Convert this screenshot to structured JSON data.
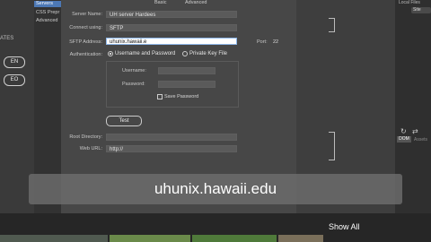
{
  "left_panel": {
    "label": "ATES",
    "buttons": [
      "EN",
      "EO"
    ]
  },
  "categories": [
    "Servers",
    "CSS Prepr",
    "Advanced"
  ],
  "tabs": [
    "Basic",
    "Advanced"
  ],
  "form": {
    "server_name_label": "Server Name:",
    "server_name_value": "UH server Hardees",
    "connect_using_label": "Connect using:",
    "connect_using_value": "SFTP",
    "sftp_address_label": "SFTP Address:",
    "sftp_address_value": "uhunix.hawaii.e",
    "port_label": "Port:",
    "port_value": "22",
    "authentication_label": "Authentication:",
    "auth_option_1": "Username and Password",
    "auth_option_2": "Private Key File",
    "username_label": "Username:",
    "password_label": "Password:",
    "save_password_label": "Save Password",
    "test_button": "Test",
    "root_directory_label": "Root Directory:",
    "web_url_label": "Web URL:",
    "web_url_value": "http://"
  },
  "right_panel": {
    "local_files": "Local Files",
    "site": "Site",
    "dom_tab": "DOM",
    "assets_tab": "Assets"
  },
  "caption": "uhunix.hawaii.edu",
  "bottom": {
    "show_all": "Show All"
  },
  "colors": {
    "selected_category": "#4c78b5",
    "caption_bg": "#6e6e6e"
  }
}
